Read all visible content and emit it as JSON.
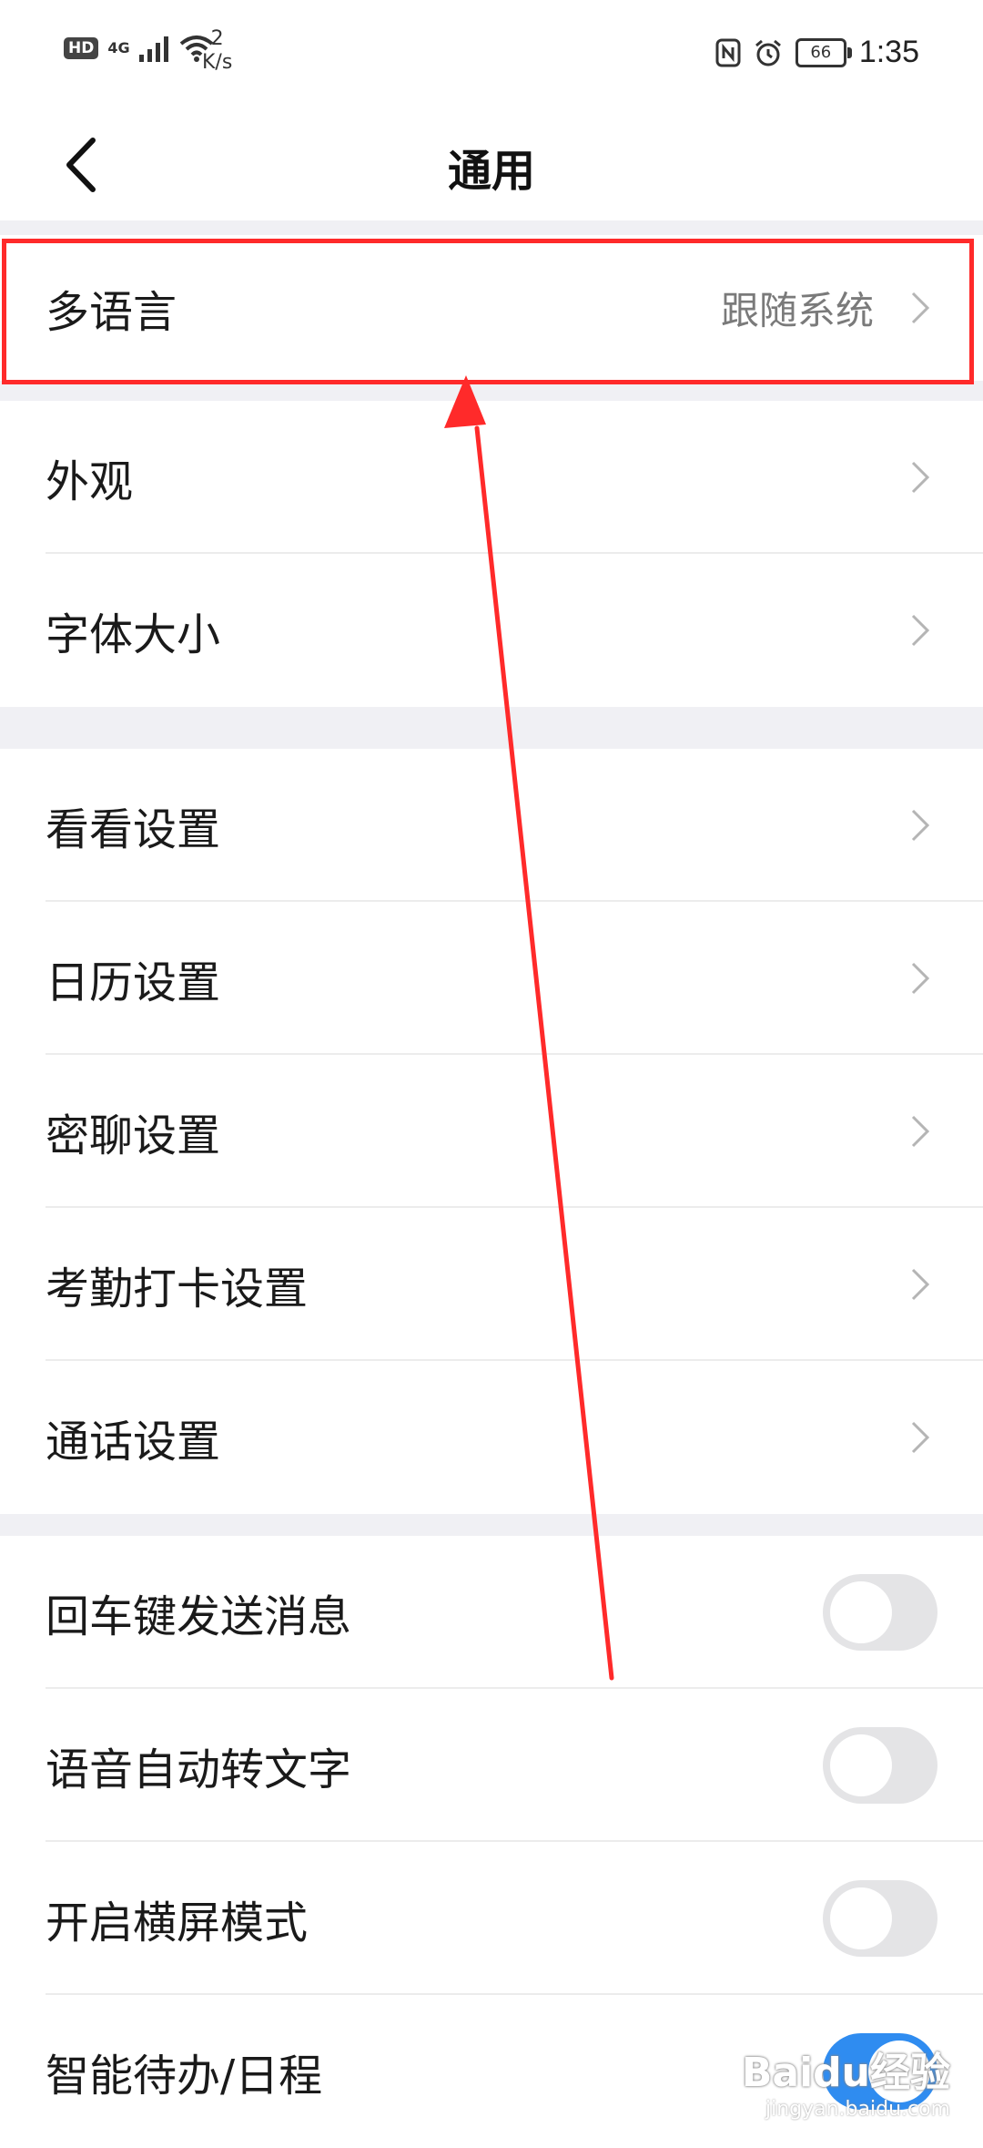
{
  "status_bar": {
    "hd": "HD",
    "network": "4G",
    "speed_value": "2",
    "speed_unit": "K/s",
    "battery": "66",
    "time": "1:35"
  },
  "nav": {
    "title": "通用"
  },
  "group1": {
    "language": {
      "label": "多语言",
      "value": "跟随系统"
    }
  },
  "group2": {
    "appearance": {
      "label": "外观"
    },
    "font_size": {
      "label": "字体大小"
    }
  },
  "group3": {
    "kankan": {
      "label": "看看设置"
    },
    "calendar": {
      "label": "日历设置"
    },
    "secret_chat": {
      "label": "密聊设置"
    },
    "attendance": {
      "label": "考勤打卡设置"
    },
    "call": {
      "label": "通话设置"
    }
  },
  "group4": {
    "enter_send": {
      "label": "回车键发送消息",
      "on": false
    },
    "voice_to_text": {
      "label": "语音自动转文字",
      "on": false
    },
    "landscape": {
      "label": "开启横屏模式",
      "on": false
    },
    "smart_todo": {
      "label": "智能待办/日程",
      "on": true
    }
  },
  "watermark": {
    "main": "Baidu经验",
    "sub": "jingyan.baidu.com"
  },
  "colors": {
    "accent": "#2f8cf0",
    "highlight": "#ff2a2a",
    "toggle_off": "#e4e4e6"
  }
}
